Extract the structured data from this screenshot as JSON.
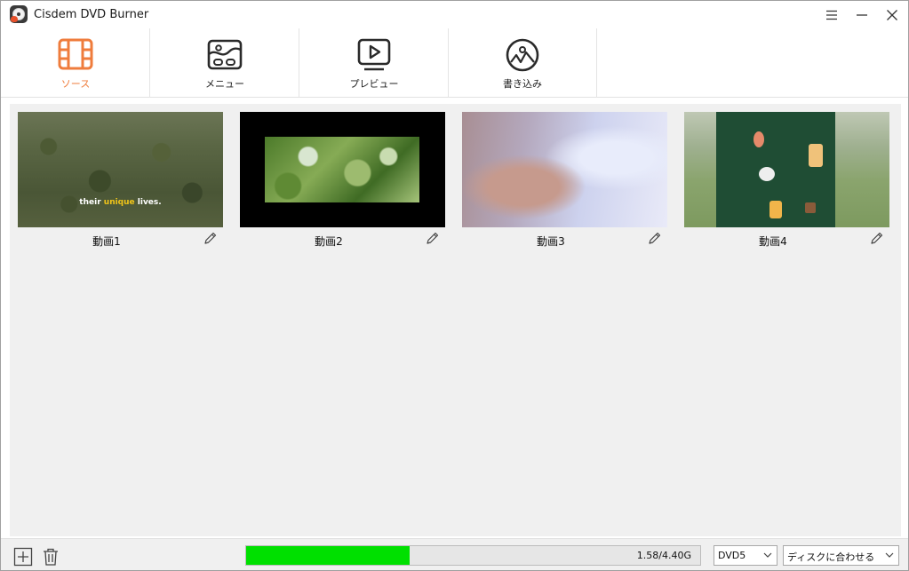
{
  "app": {
    "title": "Cisdem DVD Burner"
  },
  "tabs": [
    {
      "label": "ソース",
      "icon": "film-icon",
      "active": true
    },
    {
      "label": "メニュー",
      "icon": "menu-layout-icon",
      "active": false
    },
    {
      "label": "プレビュー",
      "icon": "preview-play-icon",
      "active": false
    },
    {
      "label": "書き込み",
      "icon": "burn-disc-icon",
      "active": false
    }
  ],
  "videos": [
    {
      "name": "動画1",
      "subtitle_pre": "their ",
      "subtitle_hl": "unique",
      "subtitle_post": " lives."
    },
    {
      "name": "動画2"
    },
    {
      "name": "動画3"
    },
    {
      "name": "動画4"
    }
  ],
  "footer": {
    "progress": 0.36,
    "size_text": "1.58/4.40G",
    "disc_type": "DVD5",
    "fit_mode": "ディスクに合わせる"
  },
  "colors": {
    "accent": "#ef7c3c",
    "progress": "#00e000"
  }
}
